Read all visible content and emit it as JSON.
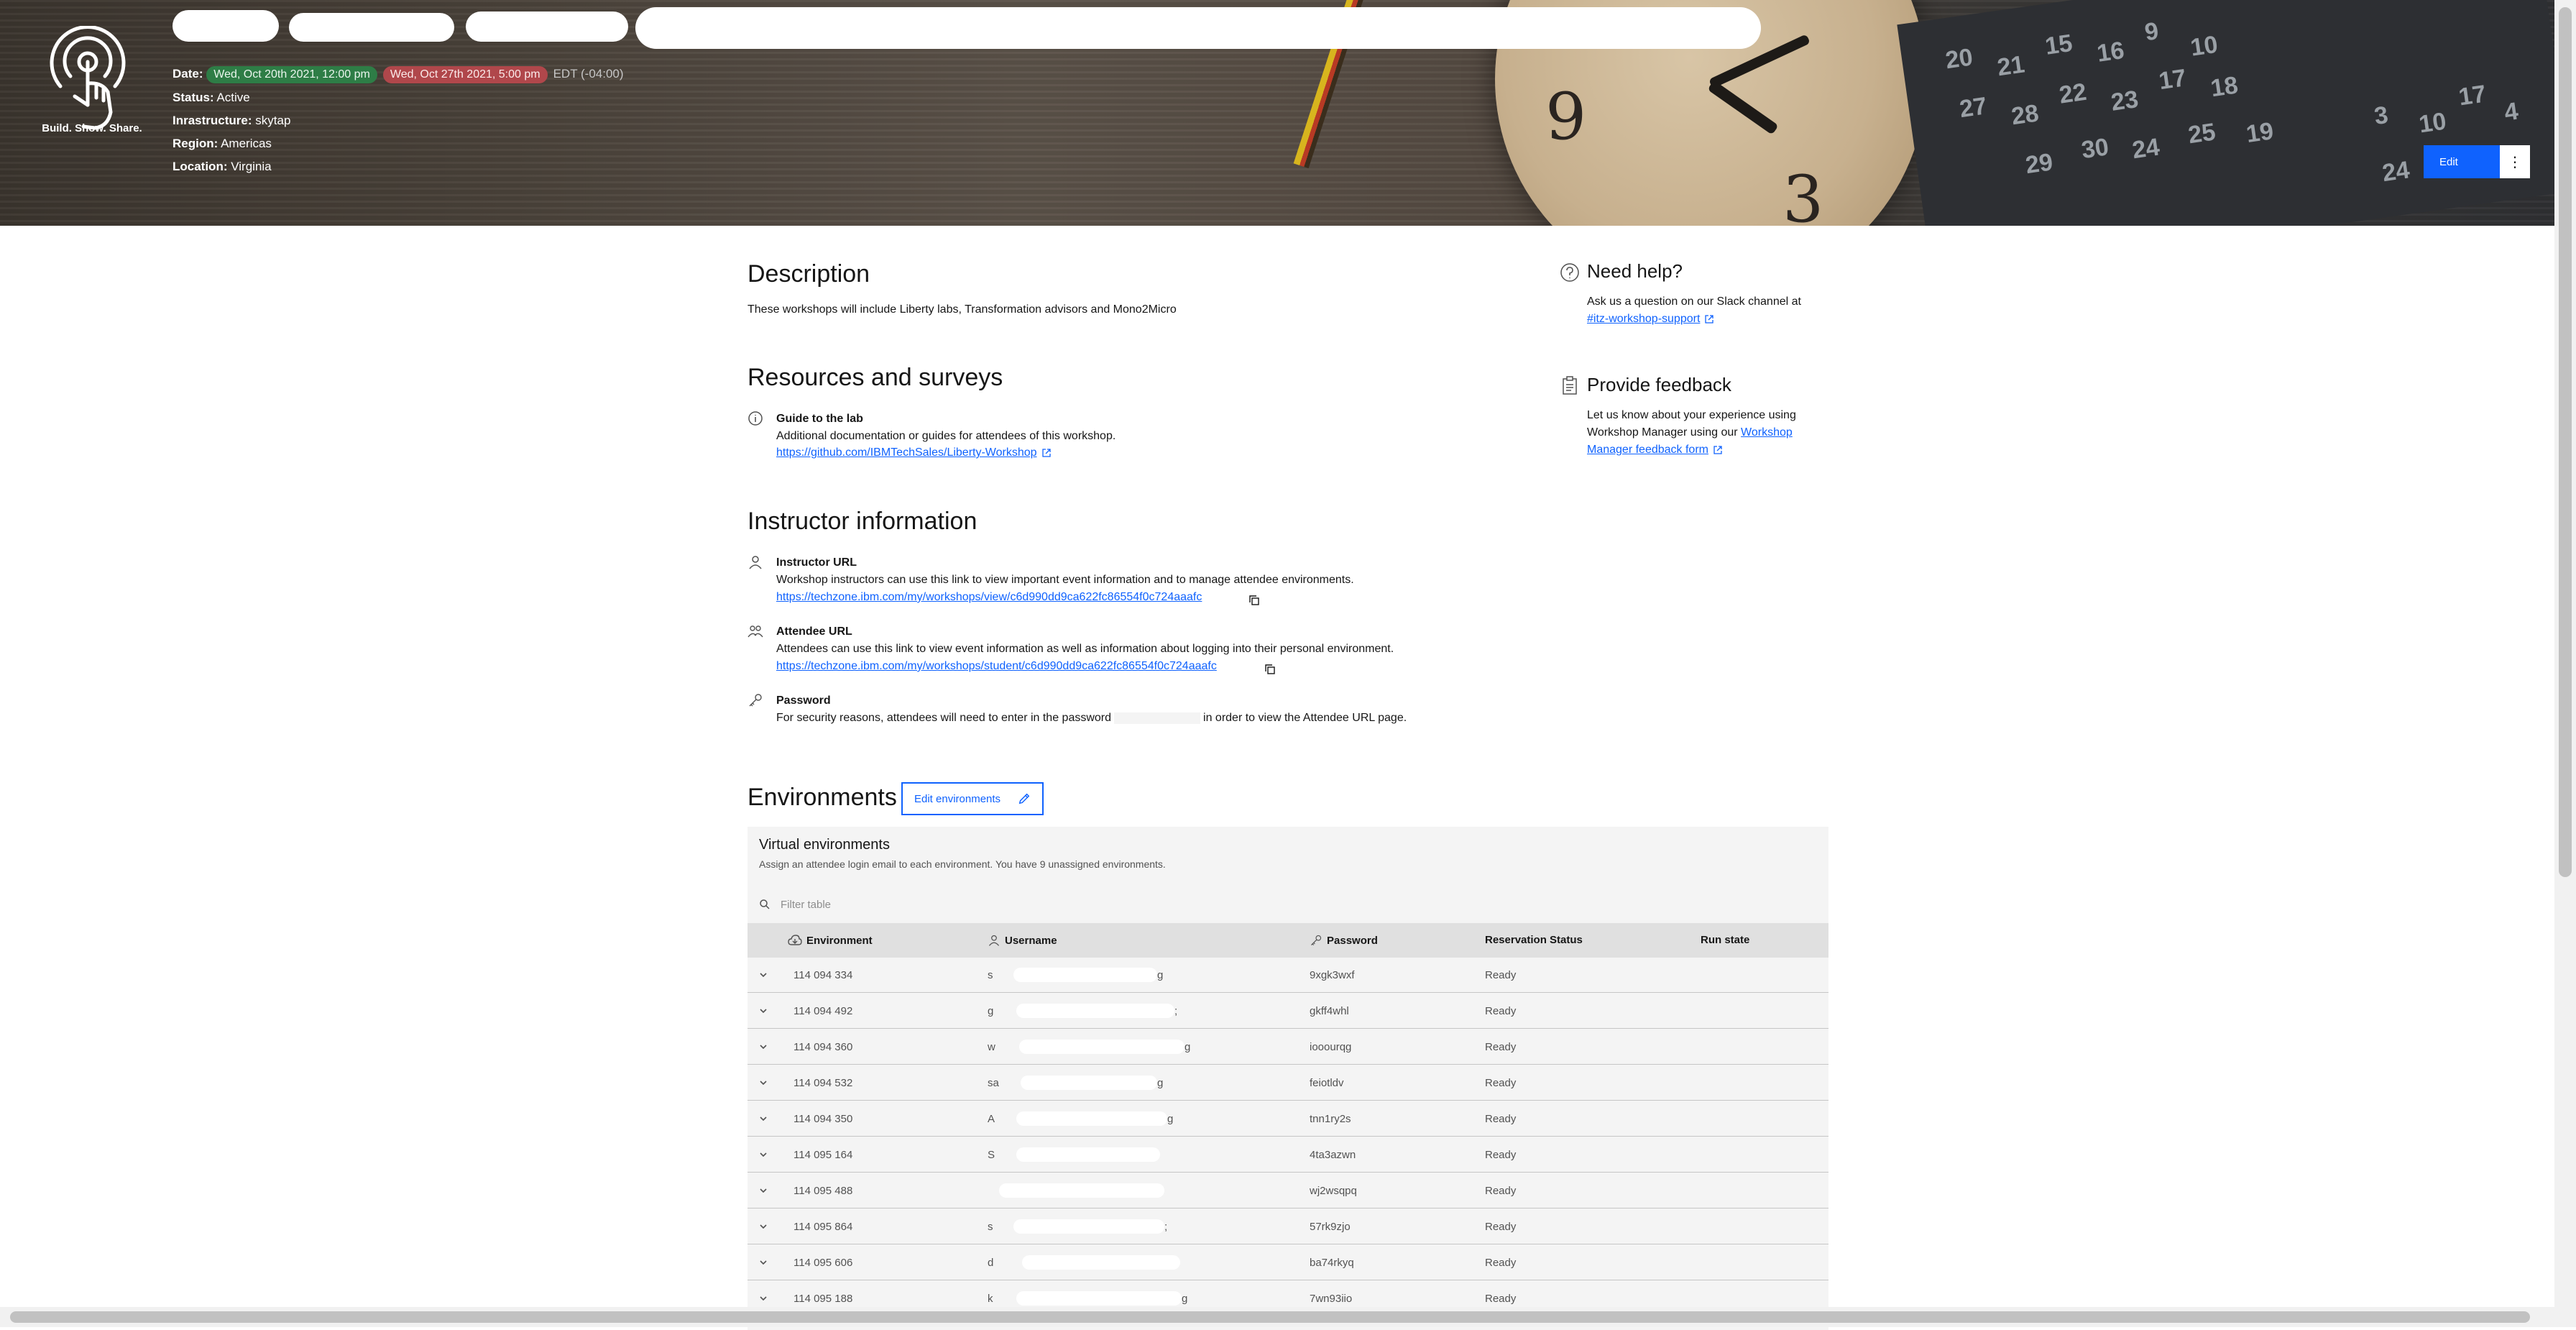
{
  "header": {
    "logo_text": "Build. Show. Share.",
    "date_label": "Date:",
    "date_start": "Wed, Oct 20th 2021, 12:00 pm",
    "date_end": "Wed, Oct 27th 2021, 5:00 pm",
    "timezone": "EDT (-04:00)",
    "status_label": "Status:",
    "status_value": "Active",
    "infra_label": "Inrastructure:",
    "infra_value": "skytap",
    "region_label": "Region:",
    "region_value": "Americas",
    "location_label": "Location:",
    "location_value": "Virginia",
    "edit_label": "Edit",
    "overflow_label": "⋮"
  },
  "description": {
    "heading": "Description",
    "text": "These workshops will include Liberty labs, Transformation advisors and Mono2Micro"
  },
  "resources": {
    "heading": "Resources and surveys",
    "guide_title": "Guide to the lab",
    "guide_desc": "Additional documentation or guides for attendees of this workshop.",
    "guide_link": "https://github.com/IBMTechSales/Liberty-Workshop"
  },
  "instructor": {
    "heading": "Instructor information",
    "instructor_url_title": "Instructor URL",
    "instructor_url_desc": "Workshop instructors can use this link to view important event information and to manage attendee environments.",
    "instructor_url_link": "https://techzone.ibm.com/my/workshops/view/c6d990dd9ca622fc86554f0c724aaafc",
    "attendee_url_title": "Attendee URL",
    "attendee_url_desc": "Attendees can use this link to view event information as well as information about logging into their personal environment.",
    "attendee_url_link": "https://techzone.ibm.com/my/workshops/student/c6d990dd9ca622fc86554f0c724aaafc",
    "password_title": "Password",
    "password_desc_pre": "For security reasons, attendees will need to enter in the password",
    "password_desc_post": "in order to view the Attendee URL page."
  },
  "help": {
    "title": "Need help?",
    "text": "Ask us a question on our Slack channel at",
    "link": "#itz-workshop-support"
  },
  "feedback": {
    "title": "Provide feedback",
    "text": "Let us know about your experience using Workshop Manager using our",
    "link": "Workshop Manager feedback form"
  },
  "environments": {
    "heading": "Environments",
    "edit_label": "Edit environments",
    "table_title": "Virtual environments",
    "table_subtitle": "Assign an attendee login email to each environment. You have 9 unassigned environments.",
    "filter_placeholder": "Filter table",
    "columns": {
      "environment": "Environment",
      "username": "Username",
      "password": "Password",
      "reservation_status": "Reservation Status",
      "run_state": "Run state"
    },
    "rows": [
      {
        "environment": "114 094 334",
        "username_start": "s",
        "username_end": "g",
        "password": "9xgk3wxf",
        "status": "Ready"
      },
      {
        "environment": "114 094 492",
        "username_start": "g",
        "username_end": ";",
        "password": "gkff4whl",
        "status": "Ready"
      },
      {
        "environment": "114 094 360",
        "username_start": "w",
        "username_end": "g",
        "password": "iooourqg",
        "status": "Ready"
      },
      {
        "environment": "114 094 532",
        "username_start": "sa",
        "username_end": "g",
        "password": "feiotldv",
        "status": "Ready"
      },
      {
        "environment": "114 094 350",
        "username_start": "A",
        "username_end": "g",
        "password": "tnn1ry2s",
        "status": "Ready"
      },
      {
        "environment": "114 095 164",
        "username_start": "S",
        "username_end": "",
        "password": "4ta3azwn",
        "status": "Ready"
      },
      {
        "environment": "114 095 488",
        "username_start": "",
        "username_end": "",
        "password": "wj2wsqpq",
        "status": "Ready"
      },
      {
        "environment": "114 095 864",
        "username_start": "s",
        "username_end": ";",
        "password": "57rk9zjo",
        "status": "Ready"
      },
      {
        "environment": "114 095 606",
        "username_start": "d",
        "username_end": "",
        "password": "ba74rkyq",
        "status": "Ready"
      },
      {
        "environment": "114 095 188",
        "username_start": "k",
        "username_end": "g",
        "password": "7wn93iio",
        "status": "Ready"
      }
    ]
  }
}
